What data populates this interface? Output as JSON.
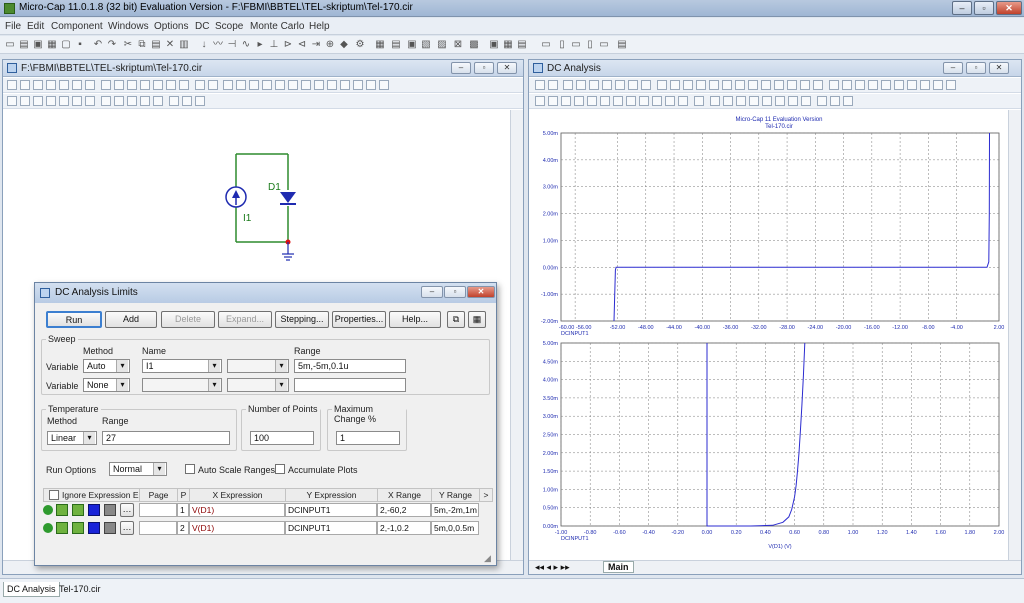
{
  "app": {
    "title": "Micro-Cap 11.0.1.8 (32 bit) Evaluation Version - F:\\FBMI\\BBTEL\\TEL-skriptum\\Tel-170.cir"
  },
  "menu": [
    "File",
    "Edit",
    "Component",
    "Windows",
    "Options",
    "DC",
    "Scope",
    "Monte Carlo",
    "Help"
  ],
  "schematic": {
    "title": "F:\\FBMI\\BBTEL\\TEL-skriptum\\Tel-170.cir",
    "diode_label": "D1",
    "source_label": "I1"
  },
  "analysis": {
    "title": "DC Analysis",
    "plot_title": "Micro-Cap 11 Evaluation Version",
    "plot_subtitle": "Tel-170.cir",
    "tab": "Main",
    "colors": {
      "trace": "#2b2bd0",
      "grid": "#7a7a7a"
    }
  },
  "dialog": {
    "title": "DC Analysis Limits",
    "buttons": {
      "run": "Run",
      "add": "Add",
      "delete": "Delete",
      "expand": "Expand...",
      "stepping": "Stepping...",
      "properties": "Properties...",
      "help": "Help..."
    },
    "sweep": {
      "caption": "Sweep",
      "method_hdr": "Method",
      "name_hdr": "Name",
      "range_hdr": "Range",
      "row1": {
        "label": "Variable",
        "method": "Auto",
        "name": "I1",
        "range": "5m,-5m,0.1u"
      },
      "row2": {
        "label": "Variable",
        "method": "None",
        "name": "",
        "range": ""
      }
    },
    "temperature": {
      "caption": "Temperature",
      "method_hdr": "Method",
      "range_hdr": "Range",
      "method": "Linear",
      "range": "27"
    },
    "points": {
      "caption": "Number of Points",
      "value": "100"
    },
    "maxchange": {
      "caption": "Maximum Change %",
      "value": "1"
    },
    "run_options": {
      "label": "Run Options",
      "value": "Normal",
      "auto_scale": "Auto Scale Ranges",
      "accumulate": "Accumulate Plots"
    },
    "table": {
      "headers": {
        "ignore": "Ignore Expression Err",
        "page": "Page",
        "p": "P",
        "x": "X Expression",
        "y": "Y Expression",
        "xr": "X Range",
        "yr": "Y Range",
        "more": ">"
      },
      "rows": [
        {
          "p": "1",
          "x": "V(D1)",
          "y": "DCINPUT1",
          "xr": "2,-60,2",
          "yr": "5m,-2m,1m"
        },
        {
          "p": "2",
          "x": "V(D1)",
          "y": "DCINPUT1",
          "xr": "2,-1,0.2",
          "yr": "5m,0,0.5m"
        }
      ]
    }
  },
  "bottom_tabs": [
    "DC Analysis",
    "Tel-170.cir"
  ],
  "chart_data": [
    {
      "type": "line",
      "title": "Micro-Cap 11 Evaluation Version",
      "subtitle": "Tel-170.cir",
      "xlabel": "DCINPUT1",
      "ylabel": "",
      "xlim": [
        -60,
        2
      ],
      "ylim": [
        -2,
        5
      ],
      "xticks": [
        "-60.00 -56.00",
        "-52.00",
        "-48.00",
        "-44.00",
        "-40.00",
        "-36.00",
        "-32.00",
        "-28.00",
        "-24.00",
        "-20.00",
        "-16.00",
        "-12.00",
        "-8.00",
        "-4.00",
        "2.00"
      ],
      "xtick_values": [
        -58,
        -52,
        -48,
        -44,
        -40,
        -36,
        -32,
        -28,
        -24,
        -20,
        -16,
        -12,
        -8,
        -4,
        2
      ],
      "yticks": [
        "5.00m",
        "4.00m",
        "3.00m",
        "2.00m",
        "1.00m",
        "0.00m",
        "-1.00m",
        "-2.00m"
      ],
      "ytick_values": [
        5,
        4,
        3,
        2,
        1,
        0,
        -1,
        -2
      ],
      "grid": true,
      "series": [
        {
          "x": [
            -52.5,
            -52.3,
            -52.2,
            -40,
            -12,
            -1.5,
            0.3,
            0.55,
            0.62,
            0.65
          ],
          "y": [
            -2,
            -0.1,
            0.0,
            0.0,
            0.0,
            0.0,
            0.0,
            0.2,
            2.0,
            5.0
          ]
        }
      ]
    },
    {
      "type": "line",
      "xlabel": "V(D1) (V)",
      "ylabel": "DCINPUT1",
      "xlim": [
        -1,
        2
      ],
      "ylim": [
        0,
        5
      ],
      "xticks": [
        "-1.00",
        "-0.80",
        "-0.60",
        "-0.40",
        "-0.20",
        "0.00",
        "0.20",
        "0.40",
        "0.60",
        "0.80",
        "1.00",
        "1.20",
        "1.40",
        "1.60",
        "1.80",
        "2.00"
      ],
      "yticks": [
        "5.00m",
        "4.50m",
        "4.00m",
        "3.50m",
        "3.00m",
        "2.50m",
        "2.00m",
        "1.50m",
        "1.00m",
        "0.50m",
        "0.00m"
      ],
      "grid": true,
      "series": [
        {
          "x": [
            0.0,
            0.0,
            0.3,
            0.45,
            0.52,
            0.56,
            0.58,
            0.6,
            0.61,
            0.62,
            0.63,
            0.64,
            0.65,
            0.66,
            0.67
          ],
          "y": [
            5.0,
            0.0,
            0.0,
            0.02,
            0.1,
            0.25,
            0.45,
            0.8,
            1.1,
            1.5,
            2.0,
            2.6,
            3.3,
            4.1,
            5.0
          ]
        }
      ]
    }
  ]
}
